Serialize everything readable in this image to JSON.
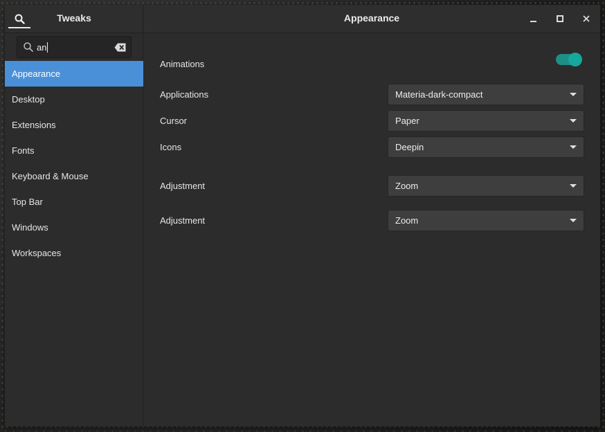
{
  "window": {
    "sidebar_title": "Tweaks",
    "page_title": "Appearance",
    "controls": [
      "minimize-icon",
      "maximize-icon",
      "close-icon"
    ]
  },
  "search": {
    "value": "an",
    "placeholder": ""
  },
  "sidebar": {
    "items": [
      {
        "label": "Appearance",
        "active": true
      },
      {
        "label": "Desktop"
      },
      {
        "label": "Extensions"
      },
      {
        "label": "Fonts"
      },
      {
        "label": "Keyboard & Mouse"
      },
      {
        "label": "Top Bar"
      },
      {
        "label": "Windows"
      },
      {
        "label": "Workspaces"
      }
    ]
  },
  "main": {
    "animations": {
      "label": "Animations",
      "enabled": true
    },
    "themes": [
      {
        "label": "Applications",
        "value": "Materia-dark-compact"
      },
      {
        "label": "Cursor",
        "value": "Paper"
      },
      {
        "label": "Icons",
        "value": "Deepin"
      }
    ],
    "adjustments": [
      {
        "label": "Adjustment",
        "value": "Zoom"
      },
      {
        "label": "Adjustment",
        "value": "Zoom"
      }
    ]
  },
  "colors": {
    "accent": "#4a90d9",
    "toggle_on": "#15a89c",
    "window_bg": "#2c2c2c",
    "combo_bg": "#3e3e3e"
  }
}
